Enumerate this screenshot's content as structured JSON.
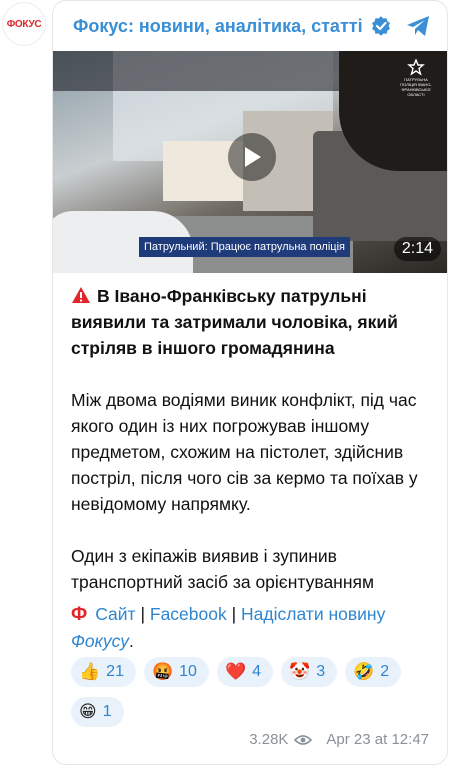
{
  "channel": {
    "avatar_text": "ФОКУС",
    "title": "Фокус: новини, аналітика, статті",
    "verified_icon": "verified-badge-icon",
    "telegram_icon": "telegram-icon",
    "accent_color": "#3a8fd6"
  },
  "video": {
    "caption": "Патрульний: Працює патрульна поліція",
    "duration": "2:14",
    "logo_text": "ПАТРУЛЬНА ПОЛІЦІЯ ІВАНО-ФРАНКІВСЬКОЇ ОБЛАСТІ"
  },
  "post": {
    "headline": "В Івано-Франківську патрульні виявили та затримали чоловіка, який стріляв в іншого громадянина",
    "paragraph1": "Між двома водіями виник конфлікт, під час якого один із них погрожував іншому предметом, схожим на пістолет, здійснив постріл, після чого сів за кермо та поїхав у невідомому напрямку.",
    "paragraph2": "Один з екіпажів виявив і зупинив транспортний засіб за орієнтуванням"
  },
  "links": {
    "site": "Сайт",
    "sep1": "|",
    "facebook": "Facebook",
    "sep2": "|",
    "send_news": "Надіслати новину",
    "focus": "Фокусу",
    "period": "."
  },
  "reactions": [
    {
      "emoji": "👍",
      "count": "21"
    },
    {
      "emoji": "🤬",
      "count": "10"
    },
    {
      "emoji": "❤️",
      "count": "4"
    },
    {
      "emoji": "🤡",
      "count": "3"
    },
    {
      "emoji": "🤣",
      "count": "2"
    },
    {
      "emoji": "😁",
      "count": "1"
    }
  ],
  "footer": {
    "views": "3.28K",
    "timestamp": "Apr 23 at 12:47"
  }
}
